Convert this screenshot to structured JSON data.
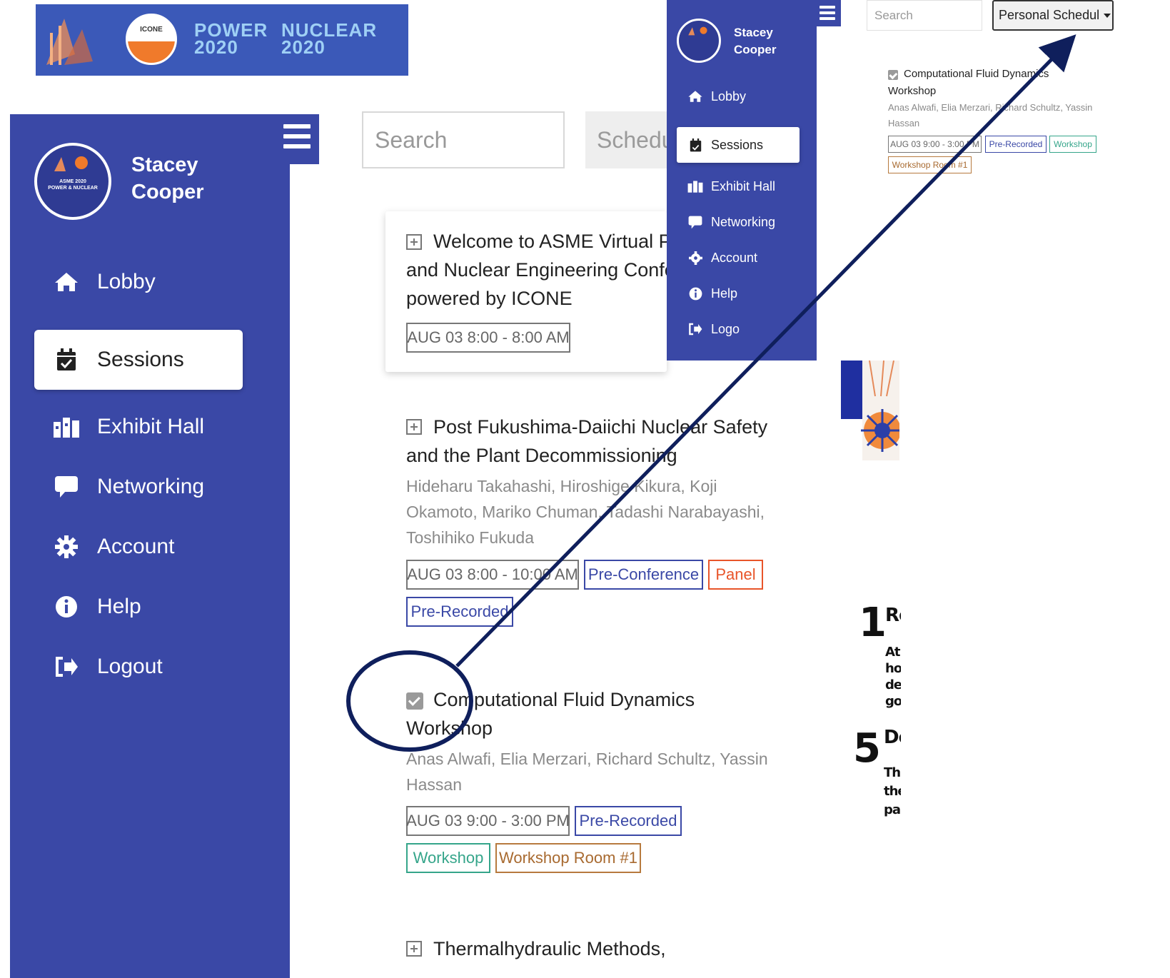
{
  "banner": {
    "word1_line1": "POWER",
    "word1_line2": "2020",
    "word2_line1": "NUCLEAR",
    "word2_line2": "2020",
    "logo_text": "ICONE"
  },
  "user": {
    "first": "Stacey",
    "last": "Cooper"
  },
  "nav": {
    "lobby": "Lobby",
    "sessions": "Sessions",
    "exhibit": "Exhibit Hall",
    "networking": "Networking",
    "account": "Account",
    "help": "Help",
    "logout": "Logout",
    "logout_mini": "Logo"
  },
  "search": {
    "placeholder": "Search",
    "schedule": "Schedul"
  },
  "sessions": [
    {
      "title_l1": "Welcome to ASME Virtual POV",
      "title_l2": "and Nuclear Engineering Confere",
      "title_l3": "powered by ICONE",
      "time": "AUG 03 8:00 - 8:00 AM"
    },
    {
      "title_l1": "Post Fukushima-Daiichi Nuclear Safety",
      "title_l2": "and the Plant Decommissioning",
      "authors_l1": "Hideharu Takahashi, Hiroshige Kikura, Koji",
      "authors_l2": "Okamoto, Mariko Chuman, Tadashi Narabayashi,",
      "authors_l3": "Toshihiko Fukuda",
      "time": "AUG 03 8:00 - 10:00 AM",
      "tag1": "Pre-Conference",
      "tag2": "Panel",
      "tag3": "Pre-Recorded"
    },
    {
      "title_l1": "Computational Fluid Dynamics",
      "title_l2": "Workshop",
      "authors_l1": "Anas Alwafi, Elia Merzari, Richard Schultz, Yassin",
      "authors_l2": "Hassan",
      "time": "AUG 03 9:00 - 3:00 PM",
      "tag1": "Pre-Recorded",
      "tag2": "Workshop",
      "tag3": "Workshop Room #1"
    },
    {
      "title_l1": "Thermalhydraulic Methods,"
    }
  ],
  "mini": {
    "search_placeholder": "Search",
    "dropdown": "Personal Schedul",
    "title_l1": "Computational Fluid Dynamics",
    "title_l2": "Workshop",
    "authors_l1": "Anas Alwafi, Elia Merzari, Richard Schultz, Yassin",
    "authors_l2": "Hassan",
    "time": "AUG 03 9:00 - 3:00 PM",
    "tag1": "Pre-Recorded",
    "tag2": "Workshop",
    "tag3": "Workshop Room #1"
  },
  "poster": {
    "num1": "1",
    "head1": "Re",
    "lines1": [
      "At",
      "ho",
      "de",
      "go"
    ],
    "num2": "5",
    "head2": "Do",
    "lines2": [
      "Th",
      "the",
      "pa"
    ]
  },
  "colors": {
    "sidebar": "#3a48a6",
    "annotation": "#0f1f5c",
    "banner": "#3b59b8"
  }
}
